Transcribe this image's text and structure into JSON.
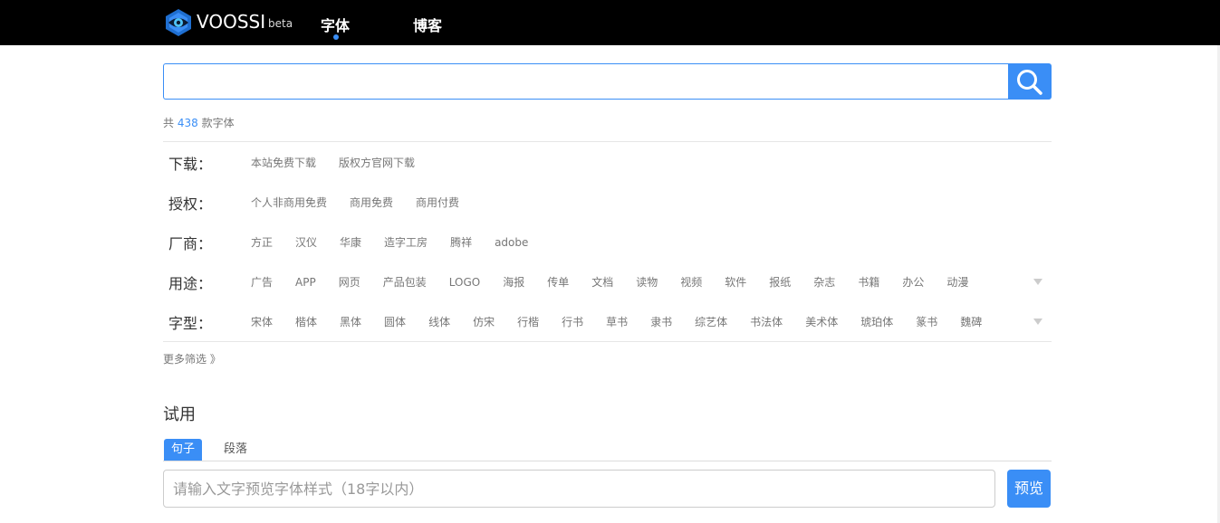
{
  "brand": {
    "name": "VOOSSI",
    "tag": "beta"
  },
  "nav": {
    "fonts": "字体",
    "blog": "博客"
  },
  "search": {
    "value": "",
    "placeholder": ""
  },
  "stats": {
    "prefix": "共",
    "count": "438",
    "suffix": "款字体"
  },
  "filters": [
    {
      "label": "下载：",
      "options": [
        "本站免费下载",
        "版权方官网下载"
      ],
      "expandable": false
    },
    {
      "label": "授权：",
      "options": [
        "个人非商用免费",
        "商用免费",
        "商用付费"
      ],
      "expandable": false
    },
    {
      "label": "厂商：",
      "options": [
        "方正",
        "汉仪",
        "华康",
        "造字工房",
        "腾祥",
        "adobe"
      ],
      "expandable": false
    },
    {
      "label": "用途：",
      "options": [
        "广告",
        "APP",
        "网页",
        "产品包装",
        "LOGO",
        "海报",
        "传单",
        "文档",
        "读物",
        "视频",
        "软件",
        "报纸",
        "杂志",
        "书籍",
        "办公",
        "动漫"
      ],
      "expandable": true
    },
    {
      "label": "字型：",
      "options": [
        "宋体",
        "楷体",
        "黑体",
        "圆体",
        "线体",
        "仿宋",
        "行楷",
        "行书",
        "草书",
        "隶书",
        "综艺体",
        "书法体",
        "美术体",
        "琥珀体",
        "篆书",
        "魏碑"
      ],
      "expandable": true
    }
  ],
  "more_filters": "更多筛选 》",
  "trial": {
    "title": "试用",
    "tabs": [
      "句子",
      "段落"
    ],
    "active_tab": "句子",
    "input_value": "",
    "input_placeholder": "请输入文字预览字体样式（18字以内）",
    "preview_button": "预览"
  },
  "colors": {
    "accent": "#3a8ef6",
    "topbar": "#000000",
    "muted_text": "#777777"
  }
}
